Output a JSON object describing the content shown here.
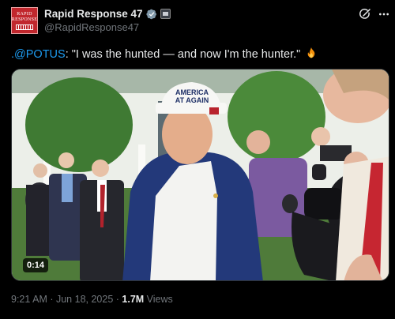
{
  "author": {
    "display_name": "Rapid Response 47",
    "handle": "@RapidResponse47",
    "avatar_text_line1": "RAPID",
    "avatar_text_line2": "RESPONSE",
    "avatar_color": "#c1272d"
  },
  "tweet": {
    "mention": ".@POTUS",
    "text": ": \"I was the hunted — and now I'm the hunter.\"",
    "emoji": "fire"
  },
  "video": {
    "duration": "0:14",
    "hat_text_line1": "AMERICA",
    "hat_text_line2": "AT AGAIN"
  },
  "meta": {
    "time": "9:21 AM",
    "separator": " · ",
    "date": "Jun 18, 2025",
    "views_count": "1.7M",
    "views_label": " Views"
  },
  "colors": {
    "background": "#000000",
    "text": "#e7e9ea",
    "secondary": "#71767b",
    "link": "#1d9bf0",
    "verified": "#829aab"
  },
  "icons": [
    "verified-badge-icon",
    "affiliate-badge-icon",
    "grok-icon",
    "more-icon",
    "fire-emoji-icon"
  ]
}
